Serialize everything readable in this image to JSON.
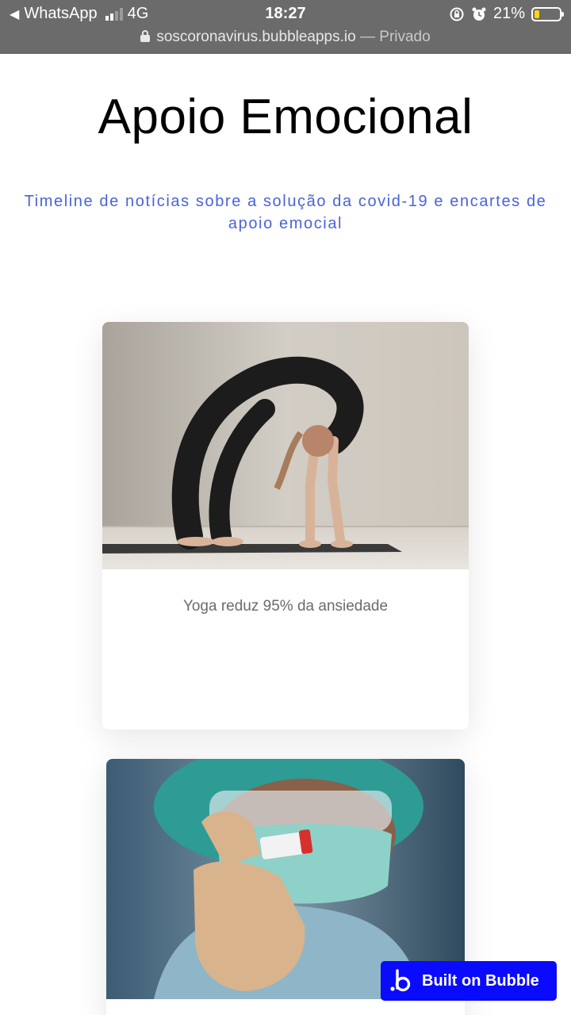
{
  "status_bar": {
    "back_app": "WhatsApp",
    "network": "4G",
    "time": "18:27",
    "battery": "21%",
    "battery_level": 0.21,
    "battery_color": "#ffd60a"
  },
  "url_bar": {
    "domain": "soscoronavirus.bubbleapps.io",
    "separator": " — ",
    "mode": "Privado"
  },
  "page": {
    "title": "Apoio Emocional",
    "subtitle": "Timeline de notícias sobre a solução da covid-19 e encartes de apoio emocial",
    "accent_color": "#4a63d8"
  },
  "cards": [
    {
      "image": "yoga-photo",
      "caption": "Yoga reduz 95% da ansiedade"
    },
    {
      "image": "vaccine-vial-photo"
    }
  ],
  "badge": {
    "label": "Built on Bubble",
    "color": "#0a0aff"
  }
}
